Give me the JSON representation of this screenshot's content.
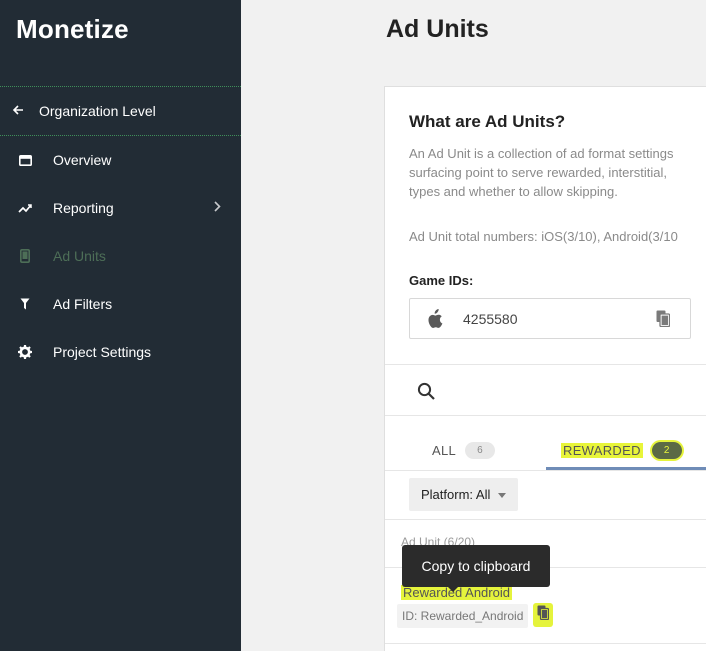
{
  "sidebar": {
    "brand": "Monetize",
    "org_link": "Organization Level",
    "items": [
      {
        "label": "Overview",
        "icon": "window-icon"
      },
      {
        "label": "Reporting",
        "icon": "trend-icon"
      },
      {
        "label": "Ad Units",
        "icon": "phone-icon"
      },
      {
        "label": "Ad Filters",
        "icon": "filter-icon"
      },
      {
        "label": "Project Settings",
        "icon": "gear-icon"
      }
    ]
  },
  "main": {
    "title": "Ad Units",
    "card": {
      "heading": "What are Ad Units?",
      "desc_lines": [
        "An Ad Unit is a collection of ad format settings",
        "surfacing point to serve rewarded, interstitial,",
        "types and whether to allow skipping."
      ],
      "totals": "Ad Unit total numbers: iOS(3/10), Android(3/10",
      "game_ids_label": "Game IDs:",
      "game_id": "4255580"
    },
    "tabs": [
      {
        "label": "ALL",
        "count": "6"
      },
      {
        "label": "REWARDED",
        "count": "2"
      }
    ],
    "platform_filter": "Platform: All",
    "column_header": "Ad Unit  (6/20)",
    "unit": {
      "name": "Rewarded Android",
      "id": "ID: Rewarded_Android"
    },
    "tooltip": "Copy to clipboard"
  },
  "colors": {
    "sidebar_bg": "#222c35",
    "active_nav": "#4d6e57",
    "highlight": "#e5f33c",
    "tab_underline": "#6f8cb7"
  }
}
